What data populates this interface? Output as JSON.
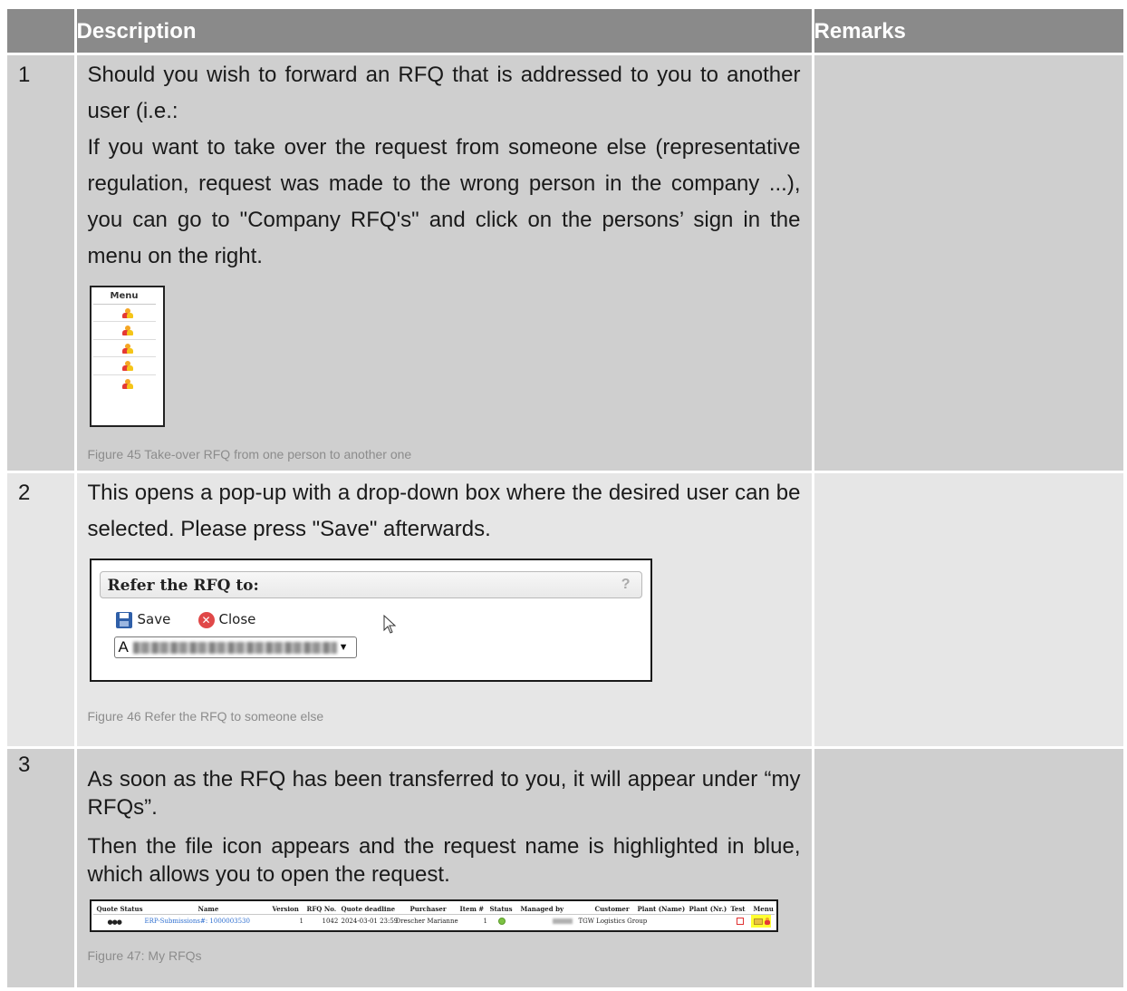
{
  "header": {
    "description": "Description",
    "remarks": "Remarks"
  },
  "rows": [
    {
      "number": "1",
      "para1": "Should you wish to forward an RFQ that is addressed to you to another user (i.e.:",
      "para2": "If you want to take over the request from someone else (representative regulation, request was made to the wrong person in the company ...), you can go to \"Company RFQ's\" and click on the persons’ sign in the menu on the right.",
      "figure": {
        "menu_header": "Menu",
        "icon": "person-icon"
      },
      "caption": "Figure 45 Take-over RFQ from one person to another one"
    },
    {
      "number": "2",
      "para1": "This opens a pop-up with a drop-down box where the desired user can be selected. Please press \"Save\" afterwards.",
      "figure": {
        "title": "Refer the RFQ to:",
        "help": "?",
        "save_label": "Save",
        "close_label": "Close",
        "selected_user_initial": "A",
        "dropdown_arrow": "▼",
        "close_glyph": "✕"
      },
      "caption": "Figure 46 Refer the RFQ to someone else"
    },
    {
      "number": "3",
      "para1": "As soon as the RFQ has been transferred to you, it will appear under “my RFQs”.",
      "para2": "Then the file icon appears and the request name is highlighted in blue, which allows you to open the request.",
      "figure": {
        "headers": [
          "Quote Status",
          "Name",
          "Version",
          "RFQ No.",
          "Quote deadline",
          "Purchaser",
          "Item #",
          "Status",
          "Managed by",
          "Customer",
          "Plant (Name)",
          "Plant (Nr.)",
          "Test",
          "Menu"
        ],
        "row": {
          "quote_status": "●●●",
          "name": "ERP-Submissions#: 1000003530",
          "version": "1",
          "rfq_no": "1042",
          "quote_deadline": "2024-03-01 23:59",
          "purchaser": "Drescher Marianne",
          "item": "1",
          "customer": "TGW Logistics Group"
        }
      },
      "caption": "Figure 47: My RFQs"
    }
  ]
}
